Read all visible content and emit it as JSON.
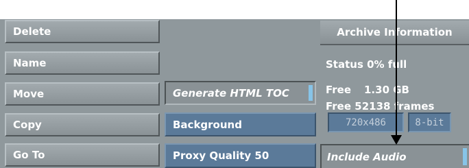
{
  "left_buttons": {
    "delete": "Delete",
    "name": "Name",
    "move": "Move",
    "copy": "Copy",
    "goto": "Go To"
  },
  "middle": {
    "generate_toc": "Generate HTML TOC",
    "background": "Background",
    "proxy_quality": "Proxy Quality 50"
  },
  "archive": {
    "header": "Archive Information",
    "status": "Status 0% full",
    "free_label": "Free",
    "free_size": "1.30 GB",
    "free_frames": "Free 52138 frames",
    "resolution": "720x486",
    "bit_depth": "8-bit",
    "include_audio": "Include Audio"
  },
  "colors": {
    "panel": "#8f989c",
    "blue_field": "#5b7a99",
    "accent": "#87c4e8"
  }
}
